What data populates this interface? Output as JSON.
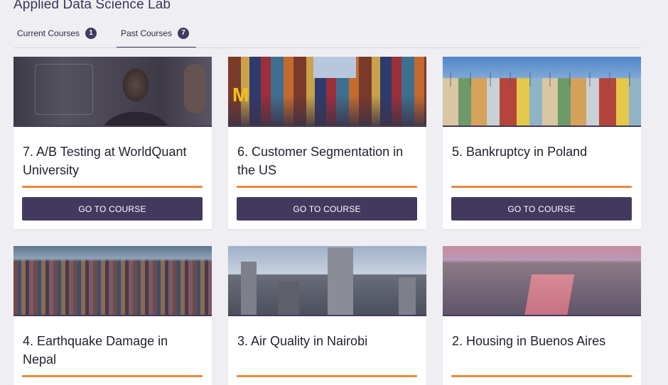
{
  "app_title": "Applied Data Science Lab",
  "tabs": [
    {
      "label": "Current Courses",
      "count": "1"
    },
    {
      "label": "Past Courses",
      "count": "7"
    }
  ],
  "courses": [
    {
      "title": "7. A/B Testing at WorldQuant University",
      "button": "GO TO COURSE",
      "image": "woman-at-glass-board"
    },
    {
      "title": "6. Customer Segmentation in the US",
      "button": "GO TO COURSE",
      "image": "times-square"
    },
    {
      "title": "5. Bankruptcy in Poland",
      "button": "GO TO COURSE",
      "image": "wroclaw-houses"
    },
    {
      "title": "4. Earthquake Damage in Nepal",
      "image": "hillside-city"
    },
    {
      "title": "3. Air Quality in Nairobi",
      "image": "nairobi-skyline"
    },
    {
      "title": "2. Housing in Buenos Aires",
      "image": "buenos-aires-river"
    }
  ],
  "colors": {
    "accent_bar": "#e8893a",
    "button_bg": "#43395f",
    "page_bg": "#efeef3"
  }
}
